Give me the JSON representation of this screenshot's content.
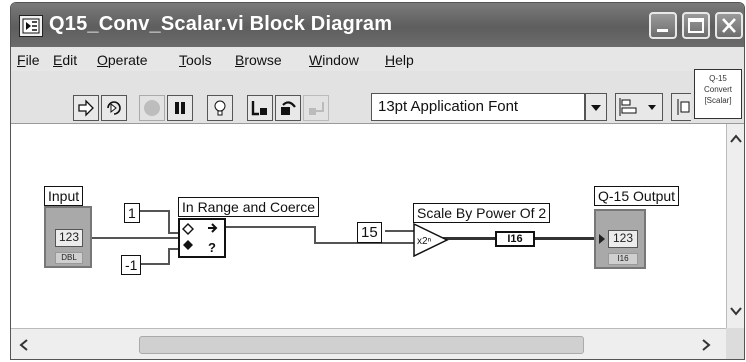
{
  "window": {
    "title": "Q15_Conv_Scalar.vi Block Diagram"
  },
  "menu": [
    {
      "label": "File",
      "mnemonic": "F",
      "rest": "ile"
    },
    {
      "label": "Edit",
      "mnemonic": "E",
      "rest": "dit"
    },
    {
      "label": "Operate",
      "mnemonic": "O",
      "rest": "perate"
    },
    {
      "label": "Tools",
      "mnemonic": "T",
      "rest": "ools"
    },
    {
      "label": "Browse",
      "mnemonic": "B",
      "rest": "rowse"
    },
    {
      "label": "Window",
      "mnemonic": "W",
      "rest": "indow"
    },
    {
      "label": "Help",
      "mnemonic": "H",
      "rest": "elp"
    }
  ],
  "toolbar": {
    "icons": [
      "run-arrow-icon",
      "run-continuously-icon",
      "abort-icon",
      "pause-icon",
      "highlight-execution-icon",
      "step-into-icon",
      "step-over-icon",
      "step-out-icon"
    ],
    "font_setting": "13pt Application Font"
  },
  "vi_icon": {
    "lines": [
      "Q-15",
      "Convert",
      "[Scalar]"
    ]
  },
  "diagram": {
    "input_label": "Input",
    "input_type": "123",
    "input_sub": "DBL",
    "const_upper": "1",
    "const_lower": "-1",
    "coerce_label": "In Range and Coerce",
    "power_const": "15",
    "scale_label": "Scale By Power Of 2",
    "convert_type": "I16",
    "output_label": "Q-15 Output",
    "output_type": "123",
    "output_sub": "I16",
    "scale_glyph": "x2ⁿ"
  }
}
